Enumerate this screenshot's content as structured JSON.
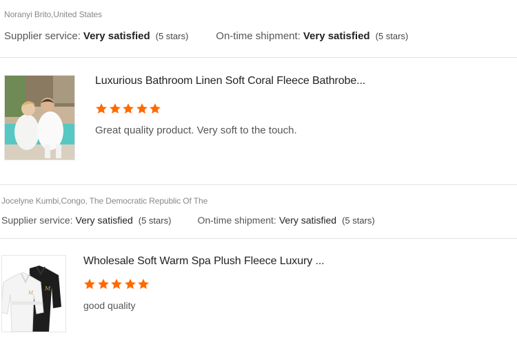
{
  "reviews": [
    {
      "reviewer": "Noranyi Brito,United States",
      "supplier_service_label": "Supplier service:",
      "supplier_service_value": "Very satisfied",
      "supplier_service_stars": "(5 stars)",
      "shipment_label": "On-time shipment:",
      "shipment_value": "Very satisfied",
      "shipment_stars": "(5 stars)",
      "product_title": "Luxurious Bathroom Linen Soft Coral Fleece Bathrobe...",
      "rating": 5,
      "comment": "Great quality product. Very soft to the touch."
    },
    {
      "reviewer": "Jocelyne Kumbi,Congo, The Democratic Republic Of The",
      "supplier_service_label": "Supplier service:",
      "supplier_service_value": "Very satisfied",
      "supplier_service_stars": "(5 stars)",
      "shipment_label": "On-time shipment:",
      "shipment_value": "Very satisfied",
      "shipment_stars": "(5 stars)",
      "product_title": "Wholesale Soft Warm Spa Plush Fleece Luxury ...",
      "rating": 5,
      "comment": "good quality"
    }
  ],
  "colors": {
    "star": "#ff6a00",
    "divider": "#e2e2e2"
  },
  "icons": {
    "star": "star-icon"
  }
}
